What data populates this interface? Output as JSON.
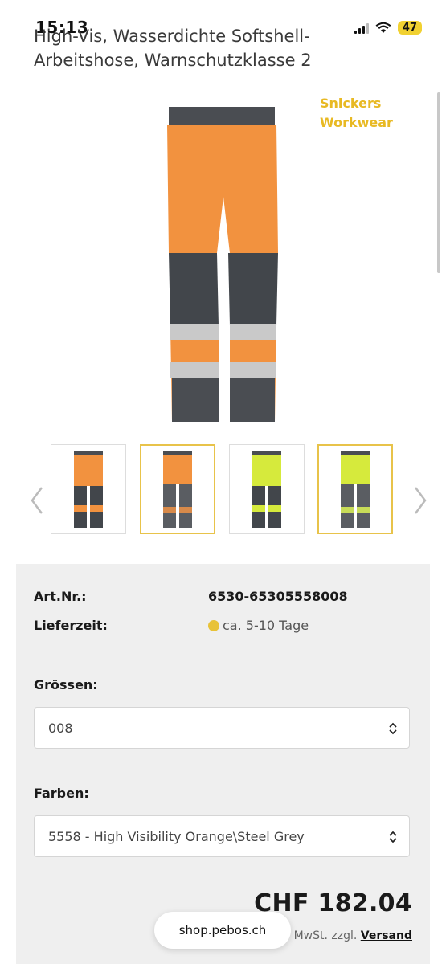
{
  "status": {
    "time": "15:13",
    "battery": "47"
  },
  "product": {
    "title": "High-Vis, Wasserdichte Softshell-Arbeitshose, Warnschutzklasse 2",
    "brand_line1": "Snickers",
    "brand_line2": "Workwear"
  },
  "gallery": {
    "thumbnails": [
      {
        "color": "orange",
        "selected": false
      },
      {
        "color": "orange",
        "selected": true
      },
      {
        "color": "yellow",
        "selected": false
      },
      {
        "color": "yellow",
        "selected": true
      }
    ]
  },
  "details": {
    "art_label": "Art.Nr.:",
    "art_value": "6530-65305558008",
    "delivery_label": "Lieferzeit:",
    "delivery_value": "ca. 5-10 Tage",
    "size_label": "Grössen:",
    "size_value": "008",
    "color_label": "Farben:",
    "color_value": "5558 - High Visibility Orange\\Steel Grey",
    "price": "CHF 182.04",
    "vat_text": "MwSt. zzgl.",
    "shipping_link": "Versand"
  },
  "browser": {
    "url": "shop.pebos.ch"
  },
  "colors": {
    "accent": "#e8b923",
    "orange": "#f2923f",
    "yellow": "#d6ea3c",
    "grey": "#4a4d52"
  }
}
